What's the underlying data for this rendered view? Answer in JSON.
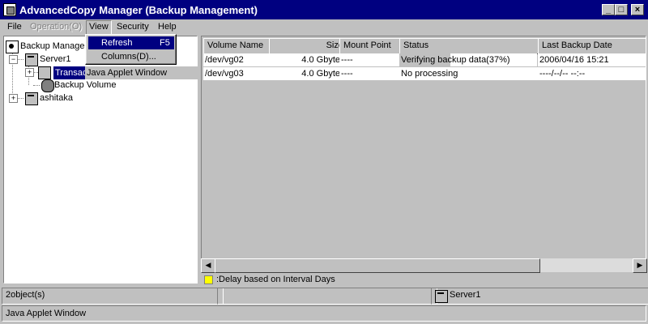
{
  "window": {
    "title": "AdvancedCopy Manager (Backup Management)",
    "minimize": "_",
    "maximize": "□",
    "close": "×"
  },
  "menu": {
    "file": "File",
    "operation": "Operation(O)",
    "view": "View",
    "security": "Security",
    "help": "Help"
  },
  "view_menu": {
    "refresh": "Refresh",
    "refresh_shortcut": "F5",
    "columns": "Columns(D)..."
  },
  "tooltip": "Java Applet Window",
  "tree": {
    "root": "Backup Manager",
    "server1": "Server1",
    "transaction": "Transac",
    "backup_volume": "Backup Volume",
    "ashitaka": "ashitaka"
  },
  "table": {
    "columns": [
      "Volume Name",
      "Size",
      "Mount Point",
      "Status",
      "Last Backup Date"
    ],
    "rows": [
      {
        "volume": "/dev/vg02",
        "size": "4.0 Gbyte",
        "mount": "----",
        "status": "Verifying backup data(37%)",
        "date": "2006/04/16 15:21",
        "progress": 0.37
      },
      {
        "volume": "/dev/vg03",
        "size": "4.0 Gbyte",
        "mount": "----",
        "status": "No processing",
        "date": "----/--/-- --:--"
      }
    ]
  },
  "legend": {
    "text": ":Delay based on Interval Days",
    "color": "#ffff00"
  },
  "status": {
    "count": "2object(s)",
    "server": "Server1",
    "applet": "Java Applet Window"
  },
  "colors": {
    "titlebar": "#000080",
    "face": "#c0c0c0",
    "selection": "#000080"
  }
}
